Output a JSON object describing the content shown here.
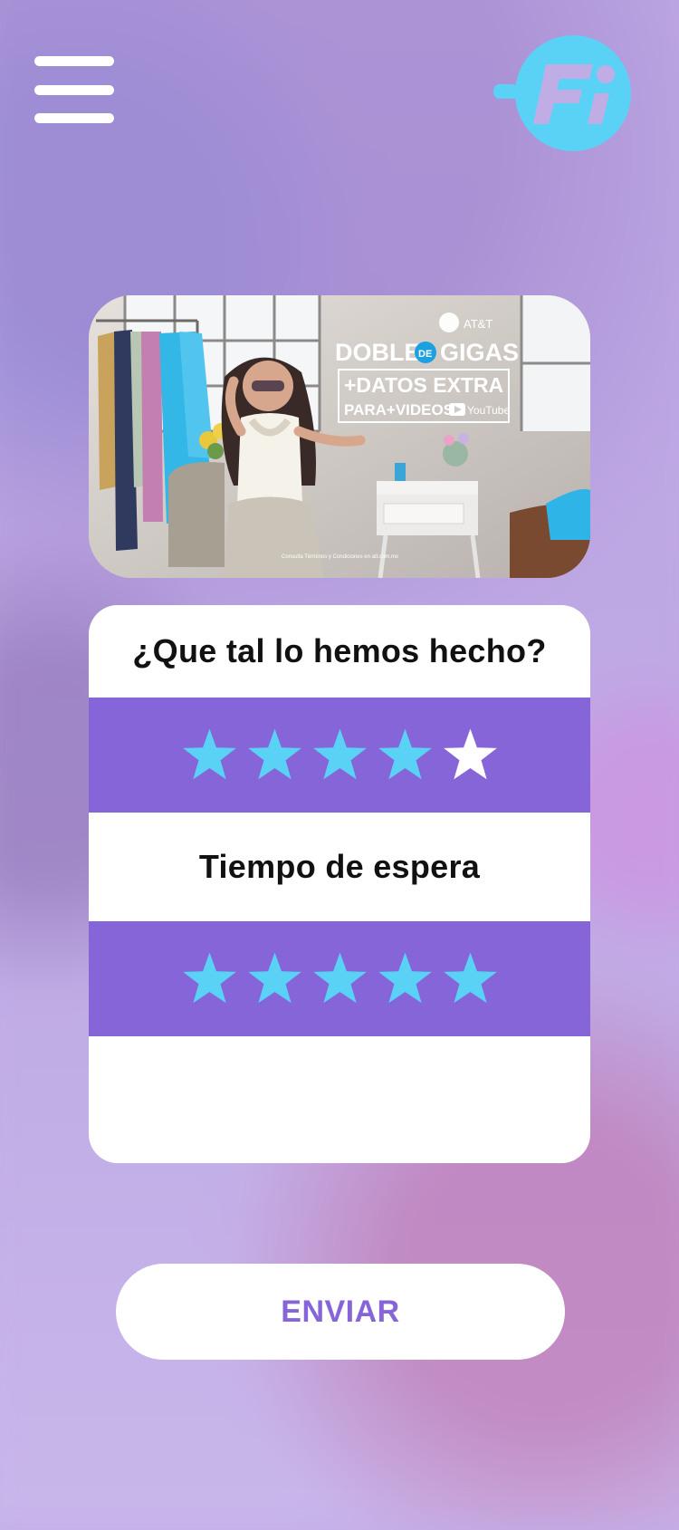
{
  "colors": {
    "accent_purple": "#8565d8",
    "star_filled": "#5ad2f5",
    "star_empty": "#ffffff",
    "logo_cyan": "#5ad2f5",
    "panel_bg": "#ffffff"
  },
  "header": {
    "menu_icon": "hamburger-menu-icon",
    "logo_icon": "fi-logo-icon",
    "logo_text": "Fi"
  },
  "promo": {
    "brand": "AT&T",
    "headline_part1": "DOBLE",
    "headline_de": "DE",
    "headline_part2": "GIGAS",
    "line2": "+DATOS EXTRA",
    "line3": "PARA+VIDEOS",
    "youtube": "YouTube",
    "disclaimer": "Consulta Términos y Condiciones en att.com.mx"
  },
  "survey": {
    "questions": [
      {
        "label": "¿Que tal lo hemos hecho?",
        "rating": 4,
        "max": 5,
        "star_icon": "star-icon"
      },
      {
        "label": "Tiempo de espera",
        "rating": 5,
        "max": 5,
        "star_icon": "star-icon"
      }
    ]
  },
  "submit": {
    "label": "ENVIAR"
  }
}
